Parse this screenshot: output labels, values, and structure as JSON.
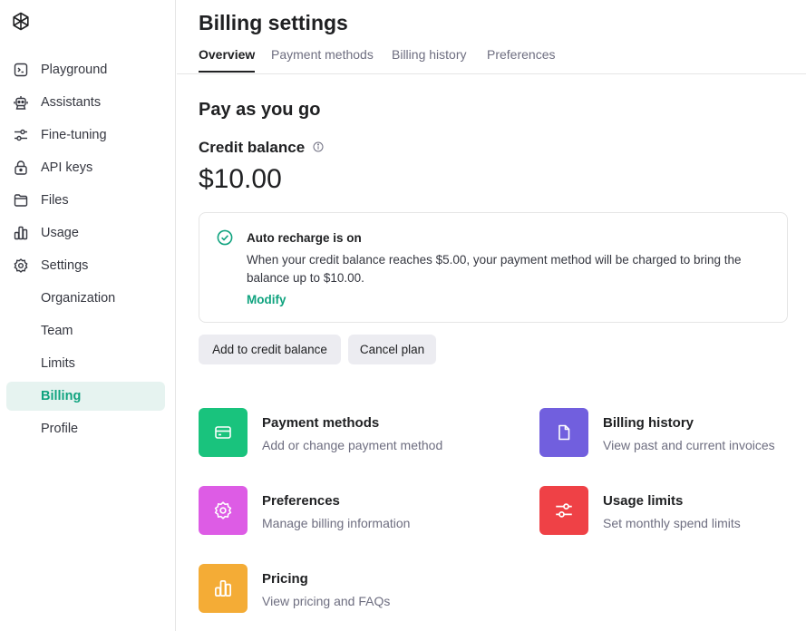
{
  "sidebar": {
    "items": [
      {
        "label": "Playground",
        "icon": "terminal-icon"
      },
      {
        "label": "Assistants",
        "icon": "robot-icon"
      },
      {
        "label": "Fine-tuning",
        "icon": "sliders-icon"
      },
      {
        "label": "API keys",
        "icon": "lock-icon"
      },
      {
        "label": "Files",
        "icon": "folder-icon"
      },
      {
        "label": "Usage",
        "icon": "bar-chart-icon"
      },
      {
        "label": "Settings",
        "icon": "gear-icon"
      },
      {
        "label": "Organization"
      },
      {
        "label": "Team"
      },
      {
        "label": "Limits"
      },
      {
        "label": "Billing",
        "active": true
      },
      {
        "label": "Profile"
      }
    ]
  },
  "header": {
    "title": "Billing settings",
    "tabs": [
      {
        "label": "Overview",
        "active": true
      },
      {
        "label": "Payment methods"
      },
      {
        "label": "Billing history"
      },
      {
        "label": "Preferences"
      }
    ]
  },
  "plan": {
    "title": "Pay as you go",
    "credit_label": "Credit balance",
    "balance": "$10.00"
  },
  "recharge": {
    "title": "Auto recharge is on",
    "description": "When your credit balance reaches $5.00, your payment method will be charged to bring the balance up to $10.00.",
    "modify_label": "Modify"
  },
  "actions": {
    "add_label": "Add to credit balance",
    "cancel_label": "Cancel plan"
  },
  "cards": [
    {
      "title": "Payment methods",
      "desc": "Add or change payment method",
      "color": "#19c37d",
      "icon": "credit-card-icon"
    },
    {
      "title": "Billing history",
      "desc": "View past and current invoices",
      "color": "#715fde",
      "icon": "document-icon"
    },
    {
      "title": "Preferences",
      "desc": "Manage billing information",
      "color": "#dd5ce5",
      "icon": "gear-icon"
    },
    {
      "title": "Usage limits",
      "desc": "Set monthly spend limits",
      "color": "#ef4146",
      "icon": "sliders-icon"
    },
    {
      "title": "Pricing",
      "desc": "View pricing and FAQs",
      "color": "#f4ac36",
      "icon": "bar-chart-icon"
    }
  ],
  "colors": {
    "accent": "#10a37f",
    "active_bg": "#e6f3f0"
  }
}
